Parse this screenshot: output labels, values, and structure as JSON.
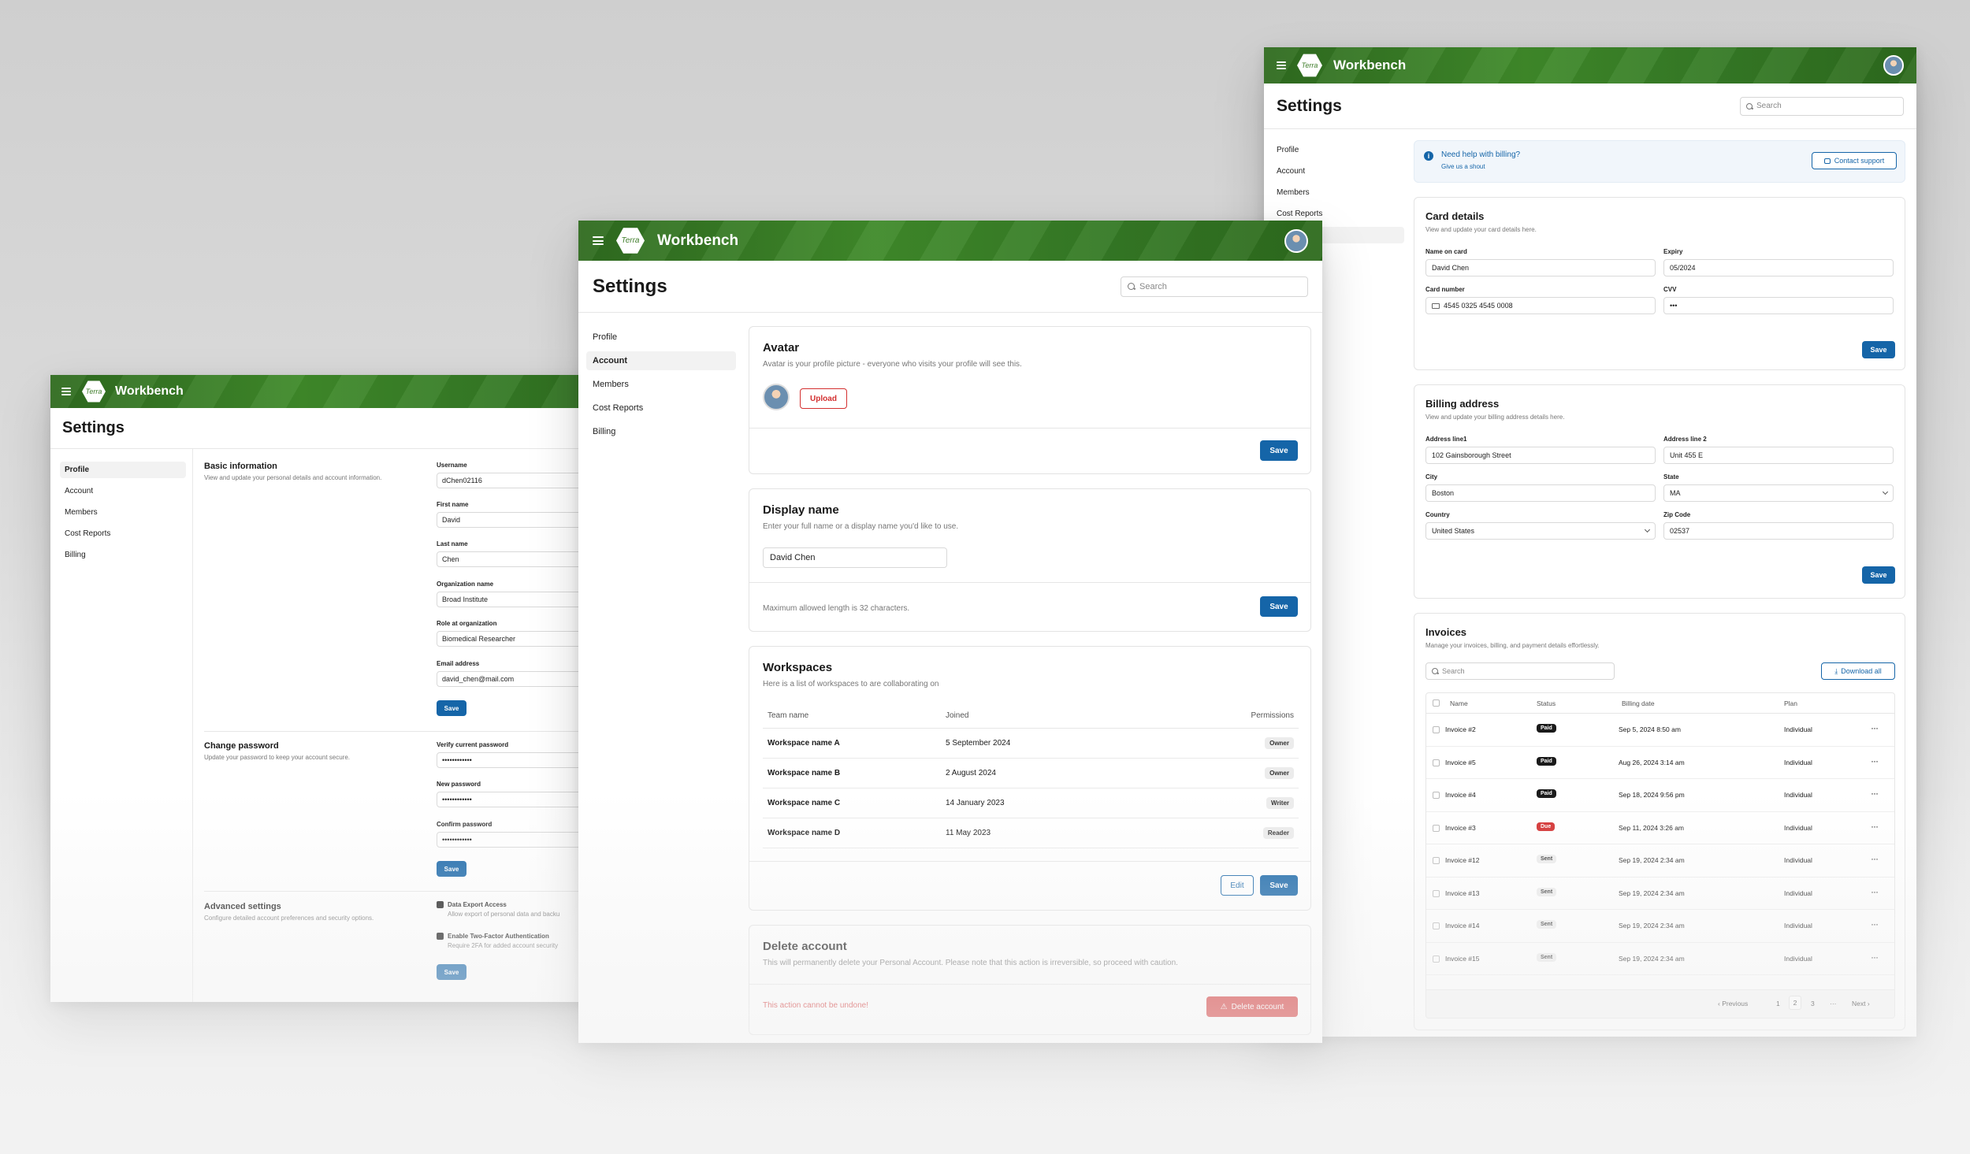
{
  "app": {
    "brand": "Workbench",
    "logo_text": "Terra",
    "page_title": "Settings",
    "search_placeholder": "Search"
  },
  "nav": [
    "Profile",
    "Account",
    "Members",
    "Cost Reports",
    "Billing"
  ],
  "profile": {
    "basic": {
      "title": "Basic information",
      "desc": "View and update your personal details and account information."
    },
    "fields": [
      {
        "label": "Username",
        "value": "dChen02116"
      },
      {
        "label": "First name",
        "value": "David"
      },
      {
        "label": "Last name",
        "value": "Chen"
      },
      {
        "label": "Organization name",
        "value": "Broad Institute"
      },
      {
        "label": "Role at organization",
        "value": "Biomedical Researcher"
      },
      {
        "label": "Email address",
        "value": "david_chen@mail.com"
      }
    ],
    "password": {
      "title": "Change password",
      "desc": "Update your password to keep your account secure."
    },
    "pw_fields": [
      {
        "label": "Verify current password",
        "value": "••••••••••••"
      },
      {
        "label": "New password",
        "value": "••••••••••••"
      },
      {
        "label": "Confirm password",
        "value": "••••••••••••"
      }
    ],
    "advanced": {
      "title": "Advanced settings",
      "desc": "Configure detailed account preferences and security options."
    },
    "adv_options": [
      {
        "label": "Data Export Access",
        "desc": "Allow export of personal data and backu"
      },
      {
        "label": "Enable Two-Factor Authentication",
        "desc": "Require 2FA for added account security"
      }
    ],
    "save": "Save"
  },
  "account": {
    "avatar": {
      "title": "Avatar",
      "desc": "Avatar is your profile picture - everyone who visits your profile will see this.",
      "upload": "Upload"
    },
    "display": {
      "title": "Display name",
      "desc": "Enter your full name or a display name you'd like to use.",
      "value": "David Chen",
      "hint": "Maximum allowed length is 32 characters."
    },
    "workspaces": {
      "title": "Workspaces",
      "desc": "Here is a list of workspaces to are collaborating on",
      "headers": [
        "Team name",
        "Joined",
        "Permissions"
      ],
      "rows": [
        {
          "name": "Workspace name A",
          "joined": "5 September 2024",
          "perm": "Owner"
        },
        {
          "name": "Workspace name B",
          "joined": "2 August 2024",
          "perm": "Owner"
        },
        {
          "name": "Workspace name C",
          "joined": "14 January 2023",
          "perm": "Writer"
        },
        {
          "name": "Workspace name D",
          "joined": "11 May 2023",
          "perm": "Reader"
        }
      ],
      "edit": "Edit"
    },
    "delete": {
      "title": "Delete account",
      "desc": "This will permanently delete your Personal Account. Please note that this action is irreversible, so proceed with caution.",
      "warn": "This action cannot be undone!",
      "button": "Delete account"
    },
    "save": "Save"
  },
  "billing": {
    "help": {
      "title": "Need help with billing?",
      "sub": "Give us a shout",
      "button": "Contact support"
    },
    "card": {
      "title": "Card details",
      "desc": "View and update your card details here.",
      "name_label": "Name on card",
      "name": "David Chen",
      "expiry_label": "Expiry",
      "expiry": "05/2024",
      "number_label": "Card number",
      "number": "4545 0325 4545 0008",
      "cvv_label": "CVV",
      "cvv": "•••"
    },
    "address": {
      "title": "Billing address",
      "desc": "View and update your billing address details here.",
      "l1_label": "Address line1",
      "l1": "102 Gainsborough Street",
      "l2_label": "Address line 2",
      "l2": "Unit 455 E",
      "city_label": "City",
      "city": "Boston",
      "state_label": "State",
      "state": "MA",
      "country_label": "Country",
      "country": "United States",
      "zip_label": "Zip Code",
      "zip": "02537"
    },
    "invoices": {
      "title": "Invoices",
      "desc": "Manage your invoices, billing, and payment details effortlessly.",
      "download": "Download all",
      "headers": [
        "Name",
        "Status",
        "Billing date",
        "Plan"
      ],
      "rows": [
        {
          "name": "Invoice #2",
          "status": "Paid",
          "date": "Sep 5, 2024 8:50 am",
          "plan": "Individual"
        },
        {
          "name": "Invoice #5",
          "status": "Paid",
          "date": "Aug 26, 2024 3:14 am",
          "plan": "Individual"
        },
        {
          "name": "Invoice #4",
          "status": "Paid",
          "date": "Sep 18, 2024 9:56 pm",
          "plan": "Individual"
        },
        {
          "name": "Invoice #3",
          "status": "Due",
          "date": "Sep 11, 2024 3:26 am",
          "plan": "Individual"
        },
        {
          "name": "Invoice #12",
          "status": "Sent",
          "date": "Sep 19, 2024 2:34 am",
          "plan": "Individual"
        },
        {
          "name": "Invoice #13",
          "status": "Sent",
          "date": "Sep 19, 2024 2:34 am",
          "plan": "Individual"
        },
        {
          "name": "Invoice #14",
          "status": "Sent",
          "date": "Sep 19, 2024 2:34 am",
          "plan": "Individual"
        },
        {
          "name": "Invoice #15",
          "status": "Sent",
          "date": "Sep 19, 2024 2:34 am",
          "plan": "Individual"
        }
      ],
      "pager": {
        "prev": "Previous",
        "pages": [
          "1",
          "2",
          "3"
        ],
        "ellipsis": "···",
        "next": "Next"
      }
    },
    "save": "Save"
  }
}
